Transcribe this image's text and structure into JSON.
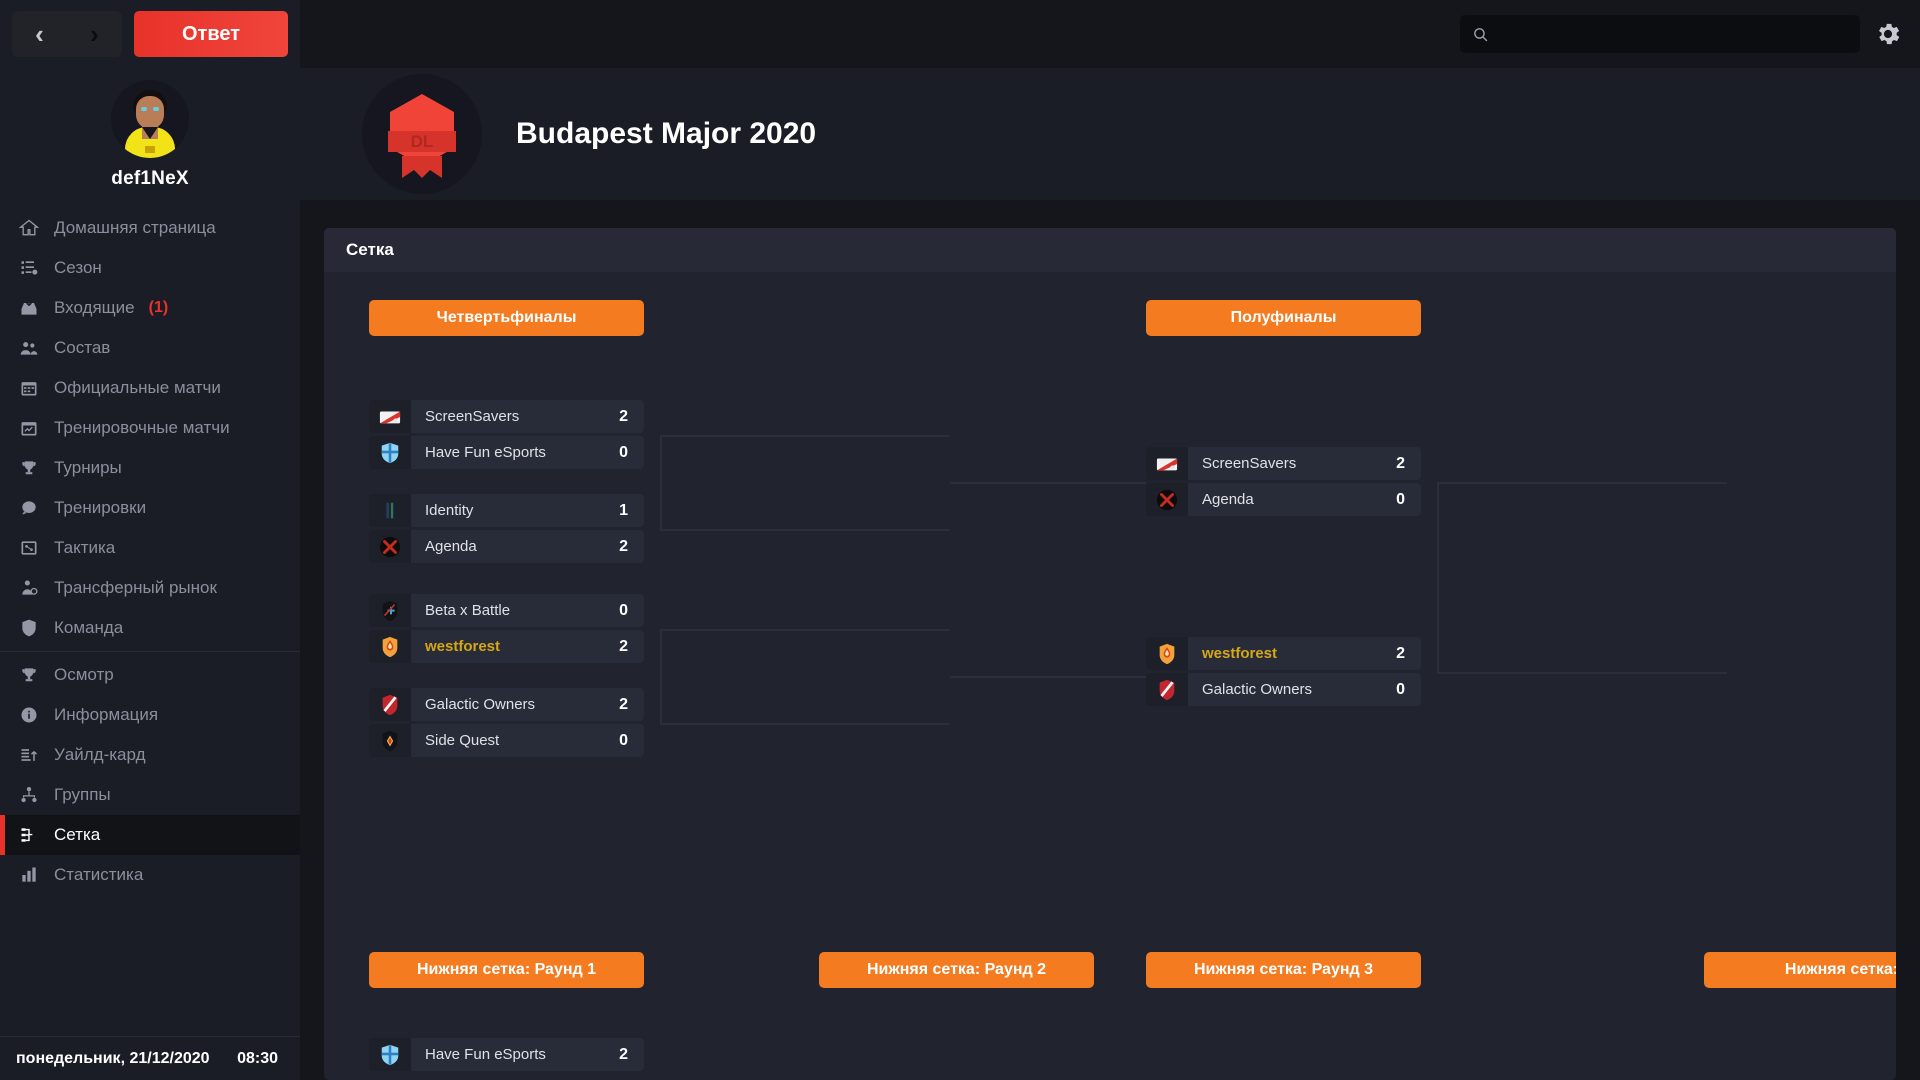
{
  "sidebar": {
    "nav_back": "‹",
    "nav_forward": "›",
    "answer_button": "Ответ",
    "username": "def1NeX",
    "items": [
      {
        "label": "Домашняя страница",
        "icon": "home-icon",
        "active": false
      },
      {
        "label": "Сезон",
        "icon": "season-icon",
        "active": false
      },
      {
        "label": "Входящие",
        "icon": "inbox-icon",
        "badge": "(1)",
        "active": false
      },
      {
        "label": "Состав",
        "icon": "squad-icon",
        "active": false
      },
      {
        "label": "Официальные матчи",
        "icon": "calendar-icon",
        "active": false
      },
      {
        "label": "Тренировочные матчи",
        "icon": "practice-calendar-icon",
        "active": false
      },
      {
        "label": "Турниры",
        "icon": "trophy-icon",
        "active": false
      },
      {
        "label": "Тренировки",
        "icon": "training-icon",
        "active": false
      },
      {
        "label": "Тактика",
        "icon": "tactics-icon",
        "active": false
      },
      {
        "label": "Трансферный рынок",
        "icon": "transfer-icon",
        "active": false
      },
      {
        "label": "Команда",
        "icon": "shield-icon",
        "active": false
      },
      {
        "label": "Осмотр",
        "icon": "trophy-icon",
        "active": false,
        "separator_before": true
      },
      {
        "label": "Информация",
        "icon": "info-icon",
        "active": false
      },
      {
        "label": "Уайлд-кард",
        "icon": "wildcard-icon",
        "active": false
      },
      {
        "label": "Группы",
        "icon": "groups-icon",
        "active": false
      },
      {
        "label": "Сетка",
        "icon": "bracket-icon",
        "active": true
      },
      {
        "label": "Статистика",
        "icon": "stats-icon",
        "active": false
      }
    ],
    "date": "понедельник, 21/12/2020",
    "time": "08:30"
  },
  "topbar": {
    "search_value": "",
    "search_placeholder": "",
    "search_icon": "search-icon",
    "settings_icon": "gear-icon"
  },
  "hero": {
    "logo_text": "DL",
    "logo_icon": "tournament-badge-icon",
    "title": "Budapest Major 2020"
  },
  "panel": {
    "title": "Сетка"
  },
  "colors": {
    "accent_orange": "#f47b20",
    "accent_red": "#e8322a",
    "own_team": "#d6a716",
    "panel_bg": "#21232e",
    "row_bg": "#282b38"
  },
  "bracket": {
    "rounds": [
      {
        "id": "qf",
        "label": "Четвертьфиналы"
      },
      {
        "id": "sf",
        "label": "Полуфиналы"
      }
    ],
    "lower_rounds": [
      {
        "id": "lb1",
        "label": "Нижняя сетка: Раунд 1"
      },
      {
        "id": "lb2",
        "label": "Нижняя сетка: Раунд 2"
      },
      {
        "id": "lb3",
        "label": "Нижняя сетка: Раунд 3"
      },
      {
        "id": "lb4",
        "label": "Нижняя сетка:"
      }
    ],
    "quarterfinals": [
      {
        "teams": [
          {
            "name": "ScreenSavers",
            "score": "2",
            "crest": "screensavers-crest",
            "own": false
          },
          {
            "name": "Have Fun eSports",
            "score": "0",
            "crest": "havefun-crest",
            "own": false
          }
        ]
      },
      {
        "teams": [
          {
            "name": "Identity",
            "score": "1",
            "crest": "identity-crest",
            "own": false
          },
          {
            "name": "Agenda",
            "score": "2",
            "crest": "agenda-crest",
            "own": false
          }
        ]
      },
      {
        "teams": [
          {
            "name": "Beta x Battle",
            "score": "0",
            "crest": "betaxbattle-crest",
            "own": false
          },
          {
            "name": "westforest",
            "score": "2",
            "crest": "westforest-crest",
            "own": true
          }
        ]
      },
      {
        "teams": [
          {
            "name": "Galactic Owners",
            "score": "2",
            "crest": "galactic-crest",
            "own": false
          },
          {
            "name": "Side Quest",
            "score": "0",
            "crest": "sidequest-crest",
            "own": false
          }
        ]
      }
    ],
    "semifinals": [
      {
        "teams": [
          {
            "name": "ScreenSavers",
            "score": "2",
            "crest": "screensavers-crest",
            "own": false
          },
          {
            "name": "Agenda",
            "score": "0",
            "crest": "agenda-crest",
            "own": false
          }
        ]
      },
      {
        "teams": [
          {
            "name": "westforest",
            "score": "2",
            "crest": "westforest-crest",
            "own": true
          },
          {
            "name": "Galactic Owners",
            "score": "0",
            "crest": "galactic-crest",
            "own": false
          }
        ]
      }
    ],
    "lower_bracket_r1": [
      {
        "teams": [
          {
            "name": "Have Fun eSports",
            "score": "2",
            "crest": "havefun-crest",
            "own": false
          }
        ]
      }
    ]
  }
}
